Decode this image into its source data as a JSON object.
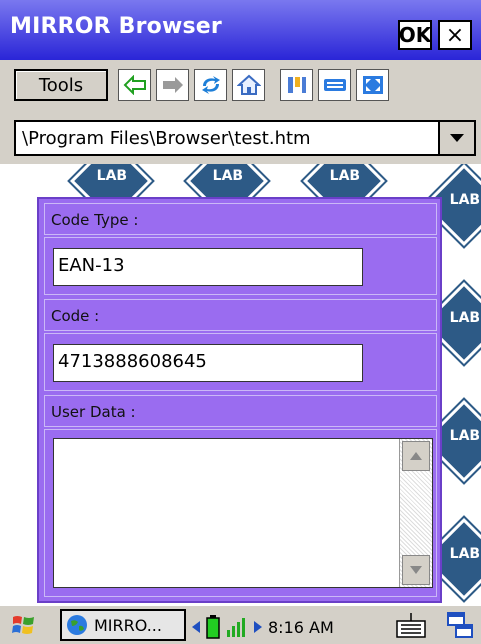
{
  "window": {
    "title": "MIRROR Browser",
    "ok_label": "OK",
    "close_label": "×"
  },
  "toolbar": {
    "tools_label": "Tools",
    "buttons": [
      "back-icon",
      "forward-icon",
      "refresh-icon",
      "home-icon",
      "settings-icon",
      "keyboard-icon",
      "fullscreen-icon"
    ]
  },
  "address": {
    "value": "\\Program Files\\Browser\\test.htm",
    "dropdown_icon": "chevron-down-icon"
  },
  "form": {
    "code_type_label": "Code Type :",
    "code_type_value": "EAN-13",
    "code_label": "Code :",
    "code_value": "4713888608645",
    "user_data_label": "User Data :",
    "user_data_value": ""
  },
  "logos": {
    "text": "LAB",
    "color": "#2d5a86"
  },
  "taskbar": {
    "task_label": "MIRRO...",
    "time": "8:16 AM"
  },
  "colors": {
    "titlebar_start": "#7a78ef",
    "titlebar_end": "#2a25d7",
    "panel": "#9a6cf0",
    "chrome": "#d4d0c8"
  }
}
